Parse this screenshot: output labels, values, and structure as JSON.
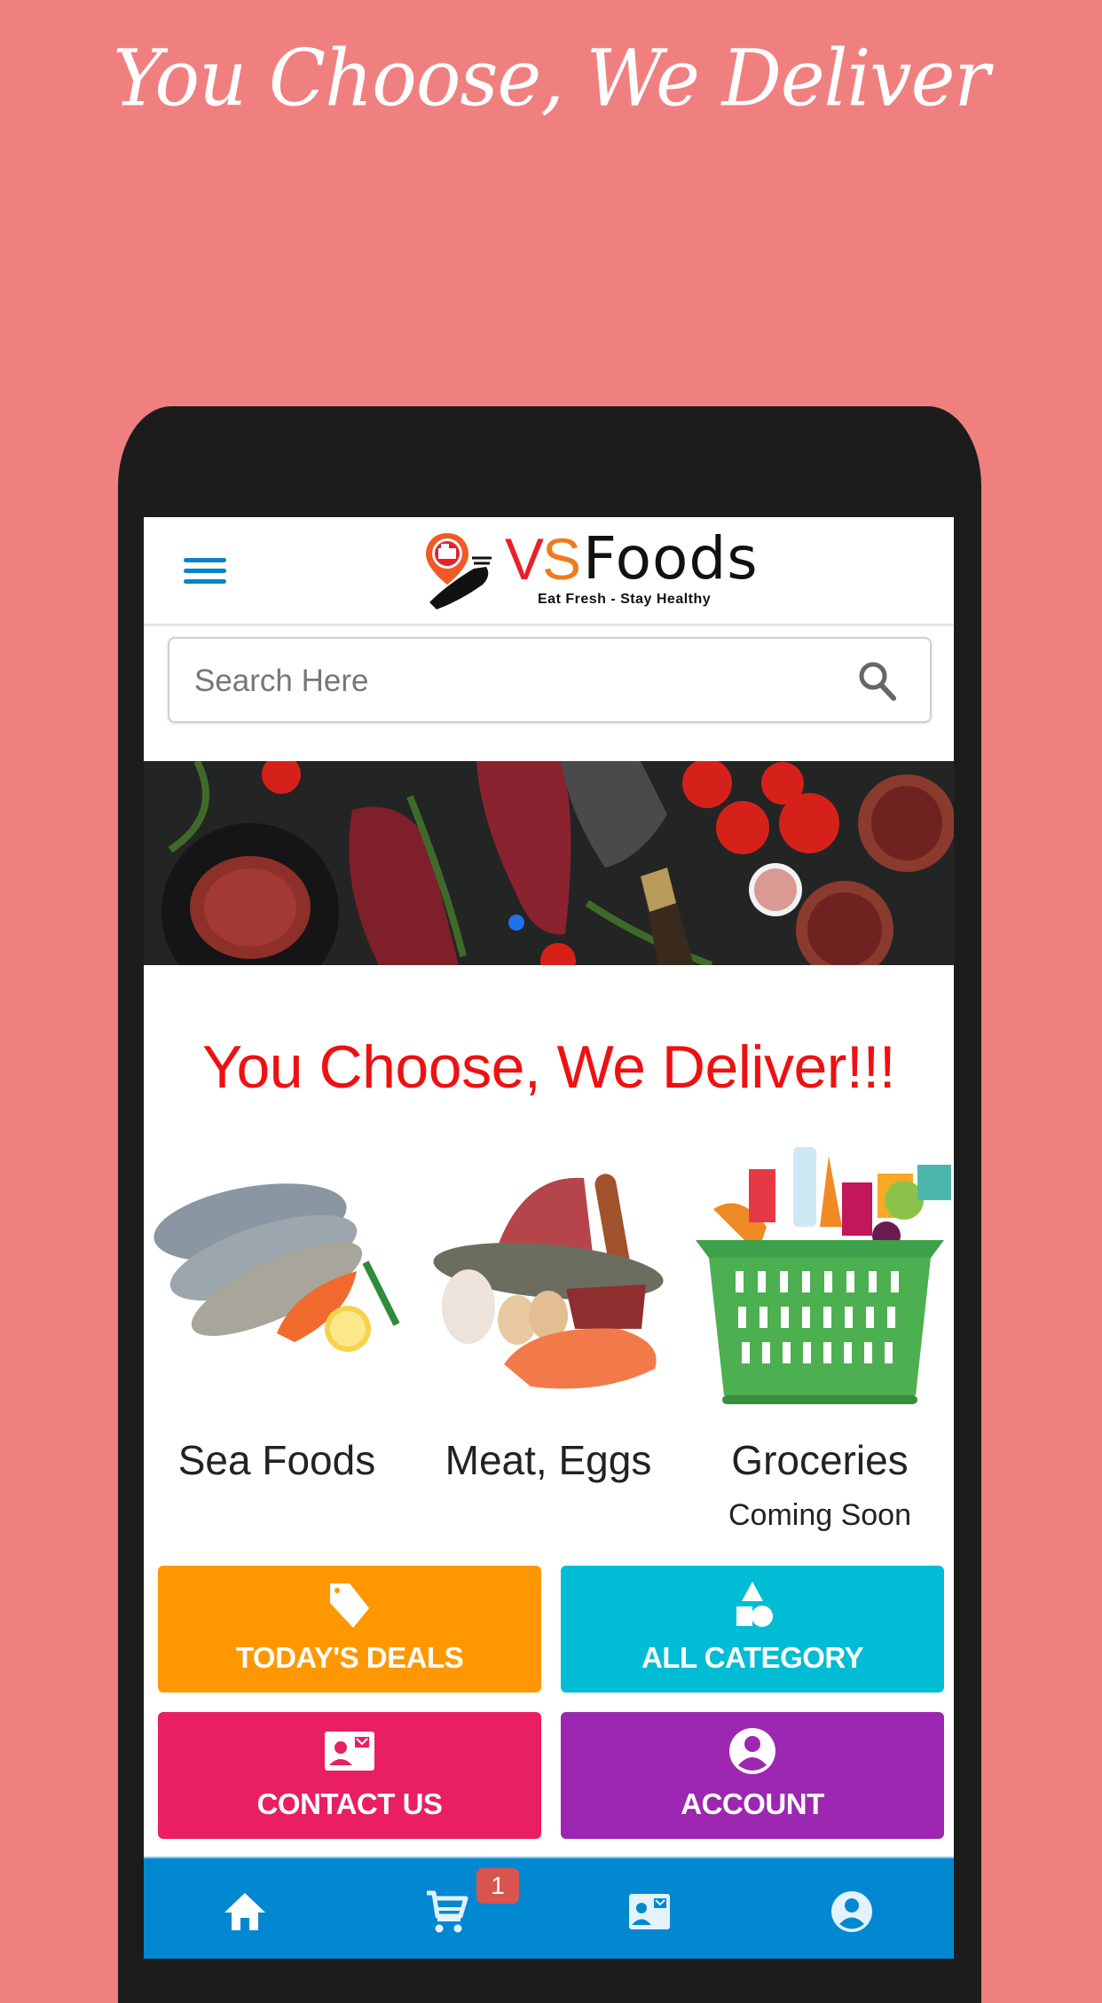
{
  "promo": {
    "heading": "You Choose, We Deliver",
    "background_color": "#F08080"
  },
  "header": {
    "menu_icon": "hamburger-menu-icon",
    "logo": {
      "brand_v": "V",
      "brand_s": "S",
      "brand_name": "Foods",
      "tagline": "Eat Fresh - Stay Healthy"
    }
  },
  "search": {
    "placeholder": "Search Here",
    "value": "",
    "icon": "search-icon"
  },
  "banner": {
    "description": "Raw steaks with tomatoes, herbs and salt",
    "active_slide": 1
  },
  "main": {
    "tagline": "You Choose, We Deliver!!!",
    "tagline_color": "#EE1111"
  },
  "categories": [
    {
      "label": "Sea Foods",
      "sublabel": ""
    },
    {
      "label": "Meat, Eggs",
      "sublabel": ""
    },
    {
      "label": "Groceries",
      "sublabel": "Coming Soon"
    }
  ],
  "actions": [
    {
      "label": "TODAY'S DEALS",
      "icon": "tag-icon",
      "color": "#FF9800"
    },
    {
      "label": "ALL CATEGORY",
      "icon": "category-shapes-icon",
      "color": "#00BCD4"
    },
    {
      "label": "CONTACT US",
      "icon": "contact-card-icon",
      "color": "#E91E63"
    },
    {
      "label": "ACCOUNT",
      "icon": "account-circle-icon",
      "color": "#9C27B0"
    }
  ],
  "bottom_nav": {
    "color": "#0288D1",
    "items": [
      {
        "name": "home",
        "icon": "home-icon"
      },
      {
        "name": "cart",
        "icon": "cart-icon",
        "badge": "1"
      },
      {
        "name": "contact",
        "icon": "contact-card-icon"
      },
      {
        "name": "account",
        "icon": "account-circle-icon"
      }
    ]
  }
}
